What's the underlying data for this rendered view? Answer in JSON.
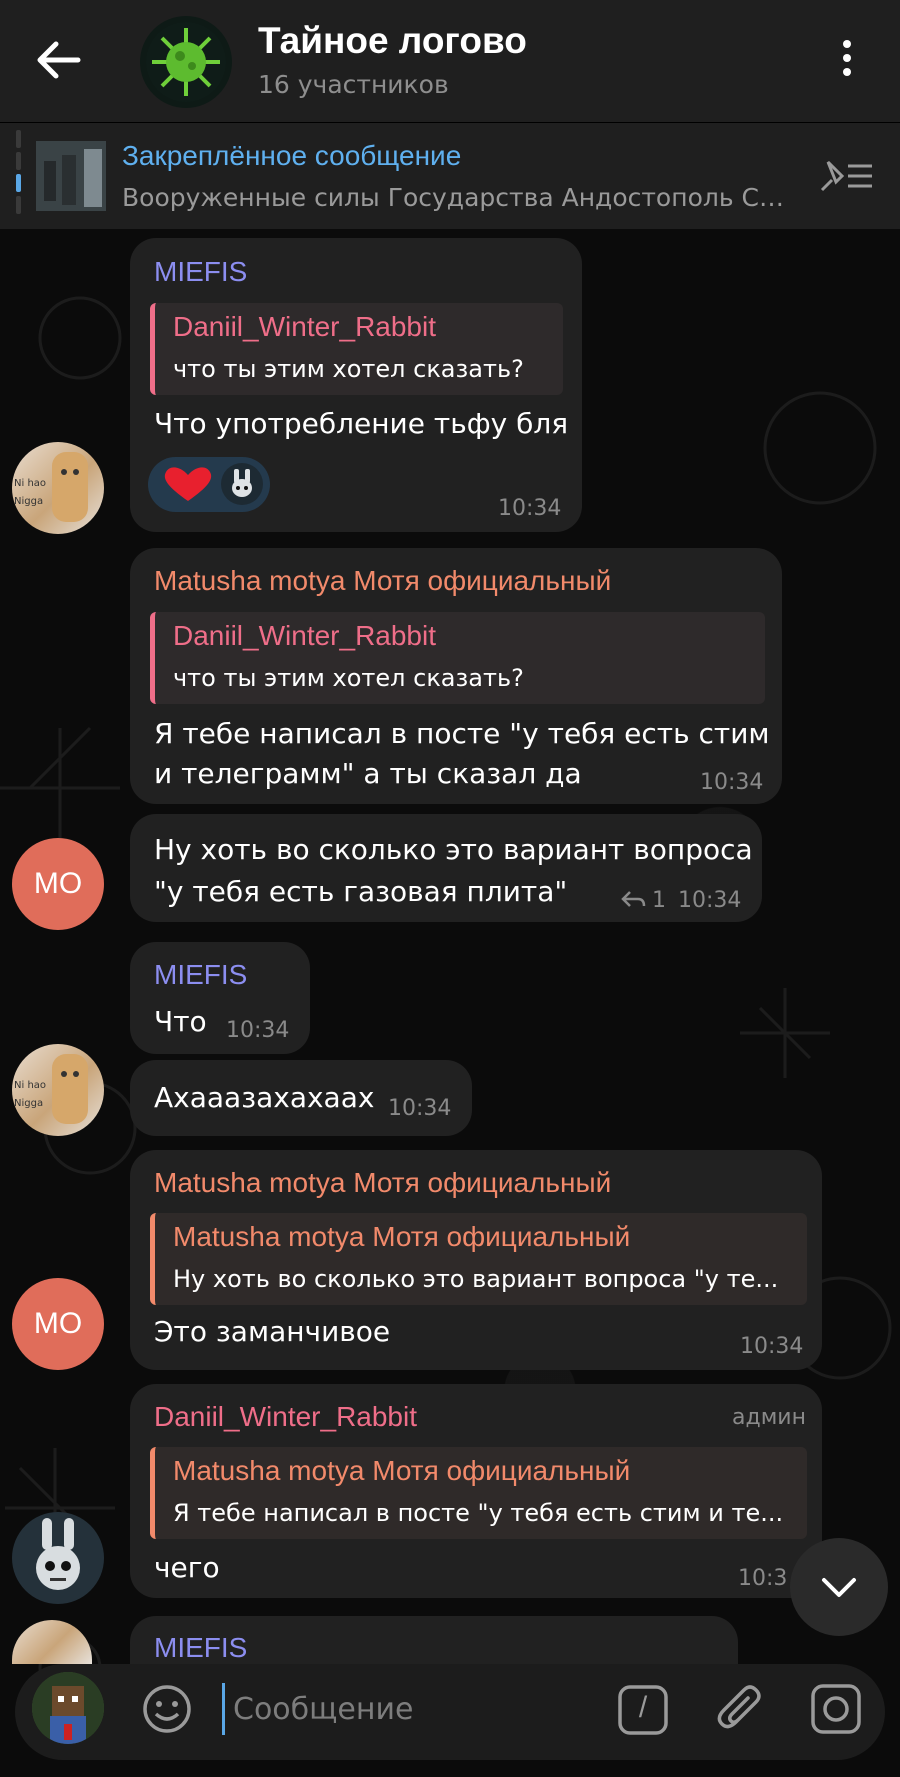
{
  "header": {
    "title": "Тайное логово",
    "subtitle": "16 участников"
  },
  "pinned": {
    "title": "Закреплённое сообщение",
    "text": "Вооруженные силы Государства Андостополь Сол..."
  },
  "messages": [
    {
      "sender": "MIEFIS",
      "reply_name": "Daniil_Winter_Rabbit",
      "reply_text": "что ты этим хотел сказать?",
      "text": "Что употребление тьфу бля",
      "time": "10:34"
    },
    {
      "sender": "Matusha motya Мотя официальный",
      "reply_name": "Daniil_Winter_Rabbit",
      "reply_text": "что ты этим хотел сказать?",
      "text_lines": [
        "Я тебе написал в посте \"у тебя есть стим",
        "и телеграмм\" а ты сказал да"
      ],
      "time": "10:34"
    },
    {
      "text_lines": [
        "Ну хоть во сколько это вариант вопроса",
        "\"у тебя есть газовая плита\""
      ],
      "reply_count": "1",
      "time": "10:34"
    },
    {
      "sender": "MIEFIS",
      "text": "Что",
      "time": "10:34"
    },
    {
      "text": "Ахааазахахаах",
      "time": "10:34"
    },
    {
      "sender": "Matusha motya Мотя официальный",
      "reply_name": "Matusha motya Мотя официальный",
      "reply_text": "Ну хоть во сколько это вариант вопроса \"у те...",
      "text": "Это заманчивое",
      "time": "10:34"
    },
    {
      "sender": "Daniil_Winter_Rabbit",
      "badge": "админ",
      "reply_name": "Matusha motya Мотя официальный",
      "reply_text": "Я тебе написал в посте \"у тебя есть стим и те...",
      "text": "чего",
      "time": "10:3"
    },
    {
      "sender": "MIEFIS"
    }
  ],
  "avatars": {
    "mo_initials": "МО",
    "cat_caption_1": "Ni hao",
    "cat_caption_2": "Nigga"
  },
  "input": {
    "placeholder": "Сообщение",
    "command_label": "/"
  },
  "colors": {
    "accent": "#5aa7e6",
    "miefis": "#8c8ef0",
    "matusha": "#f28a6b",
    "daniil": "#ef6e89"
  }
}
